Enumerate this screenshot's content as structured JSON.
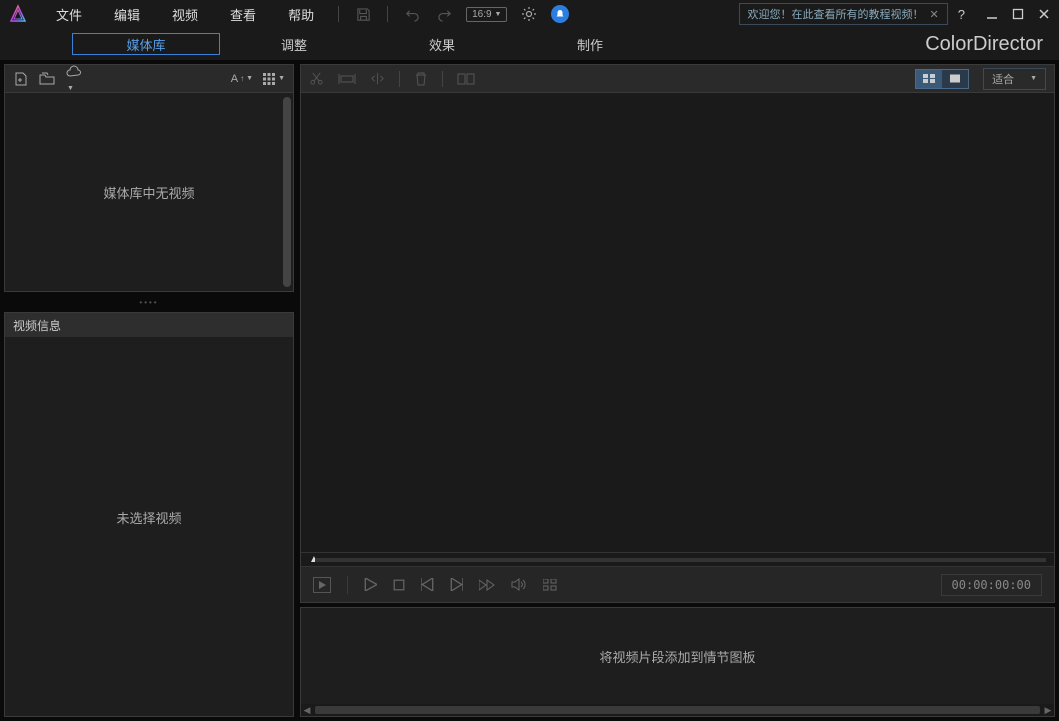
{
  "menu": {
    "file": "文件",
    "edit": "编辑",
    "video": "视频",
    "view": "查看",
    "help": "帮助"
  },
  "aspect": "16:9",
  "welcome": {
    "text": "欢迎您！在此查看所有的教程视频！",
    "help": "?"
  },
  "tabs": {
    "library": "媒体库",
    "adjust": "调整",
    "effect": "效果",
    "produce": "制作"
  },
  "brand": "ColorDirector",
  "library": {
    "empty": "媒体库中无视频"
  },
  "info": {
    "title": "视频信息",
    "empty": "未选择视频"
  },
  "fit": "适合",
  "timecode": "00:00:00:00",
  "storyboard": {
    "empty": "将视频片段添加到情节图板"
  }
}
